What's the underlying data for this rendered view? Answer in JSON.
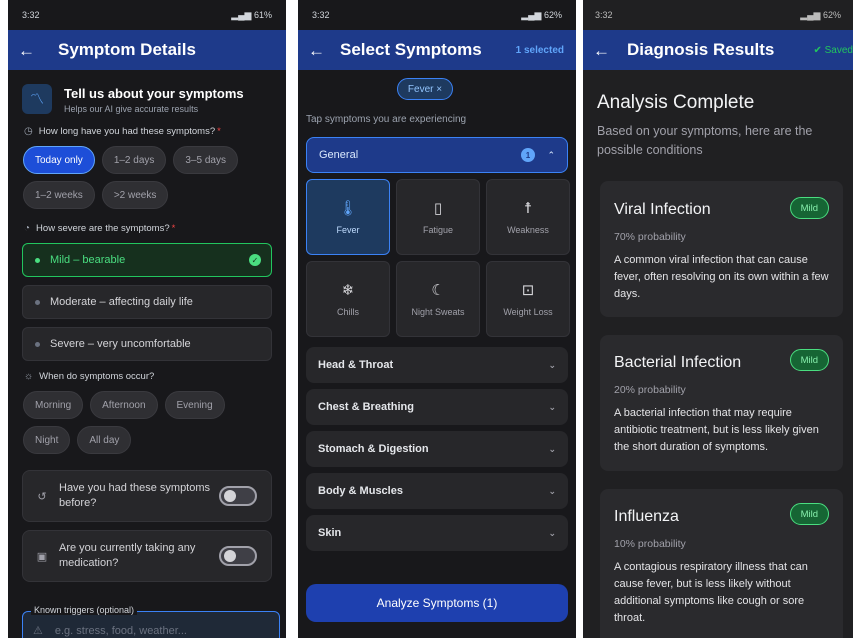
{
  "screen1": {
    "status": {
      "time": "3:32",
      "right": "61%"
    },
    "title": "Symptom Details",
    "intro": {
      "title": "Tell us about your symptoms",
      "subtitle": "Helps our AI give accurate results"
    },
    "duration": {
      "question": "How long have you had these symptoms?",
      "required": "*",
      "options": [
        "Today only",
        "1–2 days",
        "3–5 days",
        "1–2 weeks",
        ">2 weeks"
      ],
      "selected": "Today only"
    },
    "severity": {
      "question": "How severe are the symptoms?",
      "required": "*",
      "options": [
        "Mild – bearable",
        "Moderate – affecting daily life",
        "Severe – very uncomfortable"
      ],
      "selected": "Mild – bearable"
    },
    "timing": {
      "question": "When do symptoms occur?",
      "options": [
        "Morning",
        "Afternoon",
        "Evening",
        "Night",
        "All day"
      ]
    },
    "toggles": [
      {
        "label": "Have you had these symptoms before?",
        "icon": "history-icon",
        "on": false
      },
      {
        "label": "Are you currently taking any medication?",
        "icon": "medication-icon",
        "on": false
      }
    ],
    "triggers": {
      "label": "Known triggers (optional)",
      "placeholder": "e.g. stress, food, weather..."
    }
  },
  "screen2": {
    "status": {
      "time": "3:32",
      "right": "62%"
    },
    "title": "Select Symptoms",
    "selected_count": "1 selected",
    "selected_tags": [
      "Fever ×"
    ],
    "hint": "Tap symptoms you are experiencing",
    "general": {
      "label": "General",
      "count": "1",
      "items": [
        {
          "label": "Fever",
          "icon": "thermometer-icon",
          "selected": true
        },
        {
          "label": "Fatigue",
          "icon": "battery-icon",
          "selected": false
        },
        {
          "label": "Weakness",
          "icon": "person-icon",
          "selected": false
        },
        {
          "label": "Chills",
          "icon": "snowflake-icon",
          "selected": false
        },
        {
          "label": "Night Sweats",
          "icon": "moon-icon",
          "selected": false
        },
        {
          "label": "Weight Loss",
          "icon": "scale-icon",
          "selected": false
        }
      ]
    },
    "categories": [
      "Head & Throat",
      "Chest & Breathing",
      "Stomach & Digestion",
      "Body & Muscles",
      "Skin"
    ],
    "analyze_button": "Analyze Symptoms (1)"
  },
  "screen3": {
    "status": {
      "time": "3:32",
      "right": "62%"
    },
    "title": "Diagnosis Results",
    "saved": "Saved",
    "heading": "Analysis Complete",
    "lead": "Based on your symptoms, here are the possible conditions",
    "results": [
      {
        "name": "Viral Infection",
        "badge": "Mild",
        "probability": "70% probability",
        "description": "A common viral infection that can cause fever, often resolving on its own within a few days."
      },
      {
        "name": "Bacterial Infection",
        "badge": "Mild",
        "probability": "20% probability",
        "description": "A bacterial infection that may require antibiotic treatment, but is less likely given the short duration of symptoms."
      },
      {
        "name": "Influenza",
        "badge": "Mild",
        "probability": "10% probability",
        "description": "A contagious respiratory illness that can cause fever, but is less likely without additional symptoms like cough or sore throat."
      }
    ]
  }
}
